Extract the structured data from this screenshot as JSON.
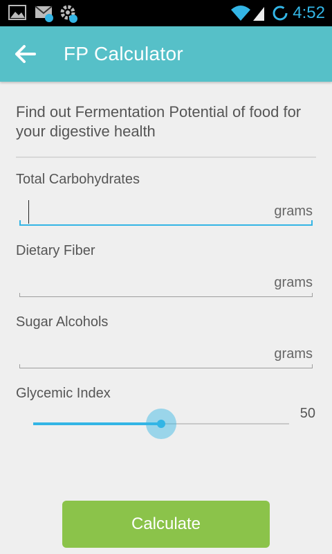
{
  "status_bar": {
    "time": "4:52",
    "icons": [
      "gallery-icon",
      "mail-icon",
      "settings-sync-icon",
      "wifi-icon",
      "signal-icon",
      "loading-icon"
    ],
    "time_color": "#33b5e5"
  },
  "app_bar": {
    "title": "FP Calculator",
    "back_icon": "arrow-left-icon",
    "color": "#56c0c8"
  },
  "intro_text": "Find out Fermentation Potential of food for your digestive health",
  "fields": [
    {
      "label": "Total Carbohydrates",
      "value": "",
      "unit": "grams",
      "focused": true
    },
    {
      "label": "Dietary Fiber",
      "value": "",
      "unit": "grams",
      "focused": false
    },
    {
      "label": "Sugar Alcohols",
      "value": "",
      "unit": "grams",
      "focused": false
    }
  ],
  "glycemic": {
    "label": "Glycemic Index",
    "value": "50",
    "fraction": 0.5,
    "accent": "#33b5e5"
  },
  "calculate_button": {
    "label": "Calculate",
    "color": "#8bc34a"
  }
}
